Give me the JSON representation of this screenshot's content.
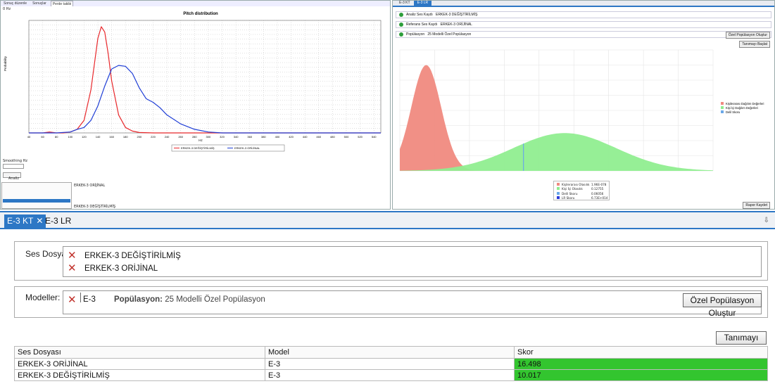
{
  "left_panel": {
    "tabs": [
      "Sonuç düzenle",
      "Sonuçlar",
      "Perde takibi"
    ],
    "subtitle": "0 Hz",
    "chart_data": {
      "type": "line",
      "title": "Pitch distribution",
      "xlabel": "Hz",
      "ylabel": "Probability",
      "x_ticks": [
        "40",
        "60",
        "80",
        "100",
        "120",
        "140",
        "160",
        "180",
        "200",
        "220",
        "240",
        "260",
        "280",
        "300",
        "320",
        "340",
        "360",
        "380",
        "400",
        "420",
        "440",
        "460",
        "480",
        "500",
        "520",
        "540"
      ],
      "xlim": [
        40,
        550
      ],
      "series": [
        {
          "name": "ERKEK-3 DEĞİŞTİRİLMİŞ",
          "color": "#e8272b",
          "x": [
            40,
            60,
            70,
            80,
            90,
            100,
            110,
            120,
            130,
            140,
            145,
            150,
            155,
            160,
            170,
            180,
            190,
            200,
            220,
            260,
            300,
            550
          ],
          "y": [
            0,
            0,
            0.001,
            0,
            0,
            0.001,
            0.004,
            0.014,
            0.048,
            0.105,
            0.118,
            0.112,
            0.088,
            0.058,
            0.02,
            0.006,
            0.002,
            0.0005,
            0,
            0,
            0,
            0
          ]
        },
        {
          "name": "ERKEK-3 ORİJİNAL",
          "color": "#1f3ed6",
          "x": [
            40,
            80,
            100,
            110,
            120,
            130,
            140,
            150,
            160,
            170,
            180,
            190,
            200,
            210,
            220,
            230,
            240,
            260,
            280,
            300,
            320,
            550
          ],
          "y": [
            0,
            0,
            0.001,
            0.004,
            0.006,
            0.014,
            0.03,
            0.052,
            0.071,
            0.075,
            0.074,
            0.066,
            0.05,
            0.038,
            0.034,
            0.028,
            0.02,
            0.01,
            0.004,
            0.001,
            0,
            0
          ]
        }
      ]
    },
    "smoothing_label": "Smoothing Hz",
    "analyze_label": "Analiz",
    "file_info": "ERKEK-3 ORİJİNAL",
    "path_text": "ERKEK-3 DEĞİŞTİRİLMİŞ"
  },
  "right_panel": {
    "tabs": [
      "E-3 KT",
      "E-3 LR"
    ],
    "rows": [
      {
        "label": "Analiz Ses Kaydı",
        "value": "ERKEK-3 DEĞİŞTİRİLMİŞ"
      },
      {
        "label": "Referans Ses Kaydı",
        "value": "ERKEK-3 ORİJİNAL"
      },
      {
        "label": "Popülasyon",
        "value": "25 Modelli Özel Popülasyon"
      }
    ],
    "btn_create": "Özel Popülasyon Oluştur",
    "btn_start": "Tanımayı Başlat",
    "btn_export": "Rapor Kaydet",
    "chart_data": {
      "type": "area",
      "series": [
        {
          "name": "Kişilerarası Dağılım Değerleri",
          "color": "#f08a80",
          "mean": -0.4,
          "sd": 0.9,
          "peak": 0.35
        },
        {
          "name": "Kişi İçi Dağılım Değerleri",
          "color": "#90ee90",
          "mean": 8.0,
          "sd": 3.1,
          "peak": 0.125
        },
        {
          "name": "Delil Skoru",
          "color": "#6aa8e8",
          "x": 5.5
        }
      ],
      "xlim": [
        -2,
        17
      ],
      "ylim": [
        0,
        0.4
      ],
      "legend_values": [
        {
          "name": "Kişilerarası Olasılık",
          "value": "1.96E-078"
        },
        {
          "name": "Kişi İçi Olasılık",
          "value": "0.12755"
        },
        {
          "name": "Delil Skoru",
          "value": "0.06056"
        },
        {
          "name": "LR Skoru",
          "value": "6.73E+014"
        }
      ]
    }
  },
  "bottom": {
    "tabs": [
      {
        "label": "E-3 KT",
        "active": true
      },
      {
        "label": "E-3 LR",
        "active": false
      }
    ],
    "files_label": "Ses Dosyaları:",
    "files": [
      "ERKEK-3 DEĞİŞTİRİLMİŞ",
      "ERKEK-3 ORİJİNAL"
    ],
    "models_label": "Modeller:",
    "model": "E-3",
    "population_label": "Popülasyon:",
    "population_value": "25 Modelli Özel Popülasyon",
    "create_button": "Özel Popülasyon Oluştur",
    "start_button": "Tanımayı Başlat",
    "table": {
      "headers": [
        "Ses Dosyası",
        "Model",
        "Skor"
      ],
      "rows": [
        {
          "file": "ERKEK-3 ORİJİNAL",
          "model": "E-3",
          "score": "16.498"
        },
        {
          "file": "ERKEK-3 DEĞİŞTİRİLMİŞ",
          "model": "E-3",
          "score": "10.017"
        }
      ]
    }
  }
}
